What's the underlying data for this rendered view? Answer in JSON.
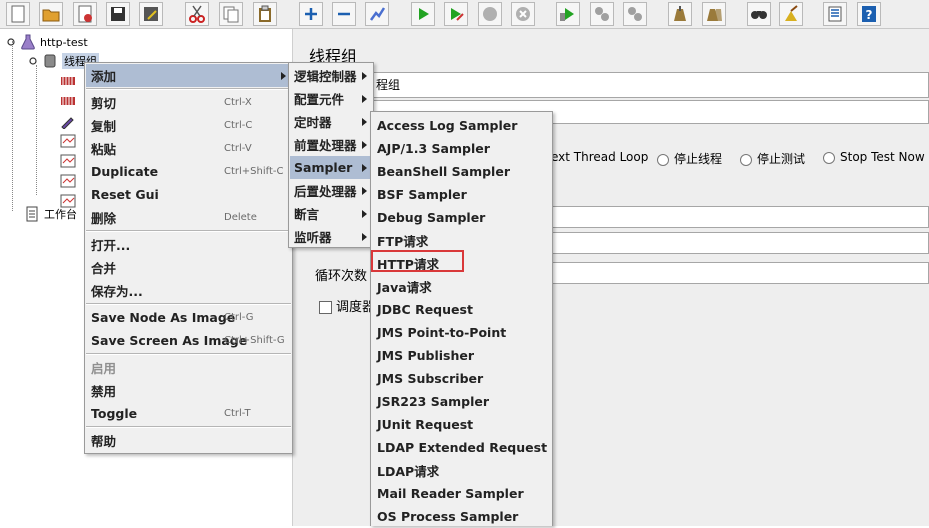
{
  "toolbar": {
    "buttons": [
      {
        "name": "new-icon",
        "color": "#ffffff"
      },
      {
        "name": "open-icon",
        "color": "#e0a030"
      },
      {
        "name": "templates-icon",
        "color": "#cc3333"
      },
      {
        "name": "save-icon",
        "color": "#333333"
      },
      {
        "name": "save-as-icon",
        "color": "#555555"
      },
      {
        "name": "cut-icon",
        "color": "#cc2222"
      },
      {
        "name": "copy-icon",
        "color": "#777777"
      },
      {
        "name": "paste-icon",
        "color": "#8a6a2a"
      },
      {
        "name": "expand-icon",
        "color": "#1b5fb0"
      },
      {
        "name": "collapse-icon",
        "color": "#1b5fb0"
      },
      {
        "name": "toggle-icon",
        "color": "#4a6fd0"
      },
      {
        "name": "start-icon",
        "color": "#22a322"
      },
      {
        "name": "start-no-pause-icon",
        "color": "#22a322"
      },
      {
        "name": "stop-icon",
        "color": "#b0b0b0"
      },
      {
        "name": "shutdown-icon",
        "color": "#b0b0b0"
      },
      {
        "name": "remote-start-icon",
        "color": "#22a322"
      },
      {
        "name": "remote-stop-icon",
        "color": "#a0a0a0"
      },
      {
        "name": "remote-shutdown-icon",
        "color": "#a0a0a0"
      },
      {
        "name": "clear-icon",
        "color": "#9a7a3a"
      },
      {
        "name": "clear-all-icon",
        "color": "#9a7a3a"
      },
      {
        "name": "search-icon",
        "color": "#333333"
      },
      {
        "name": "reset-search-icon",
        "color": "#d8b020"
      },
      {
        "name": "function-helper-icon",
        "color": "#1b5fb0"
      },
      {
        "name": "help-icon",
        "color": "#1b5fb0"
      }
    ]
  },
  "tree": {
    "root": "http-test",
    "thread_group": "线程组",
    "workbench": "工作台"
  },
  "right_panel": {
    "title": "线程组",
    "name_suffix": "程组",
    "next_thread_loop": "ext Thread Loop",
    "stop_thread": "停止线程",
    "stop_test": "停止测试",
    "stop_test_now": "Stop Test Now",
    "loop_count": "循环次数",
    "scheduler": "调度器"
  },
  "context_menu": {
    "items": [
      {
        "label": "添加",
        "shortcut": "",
        "submenu": true,
        "highlighted": true
      },
      {
        "label": "剪切",
        "shortcut": "Ctrl-X"
      },
      {
        "label": "复制",
        "shortcut": "Ctrl-C"
      },
      {
        "label": "粘贴",
        "shortcut": "Ctrl-V"
      },
      {
        "label": "Duplicate",
        "shortcut": "Ctrl+Shift-C"
      },
      {
        "label": "Reset Gui",
        "shortcut": ""
      },
      {
        "label": "删除",
        "shortcut": "Delete"
      },
      {
        "label": "打开...",
        "shortcut": ""
      },
      {
        "label": "合并",
        "shortcut": ""
      },
      {
        "label": "保存为...",
        "shortcut": ""
      },
      {
        "label": "Save Node As Image",
        "shortcut": "Ctrl-G"
      },
      {
        "label": "Save Screen As Image",
        "shortcut": "Ctrl+Shift-G"
      },
      {
        "label": "启用",
        "shortcut": "",
        "disabled": true
      },
      {
        "label": "禁用",
        "shortcut": ""
      },
      {
        "label": "Toggle",
        "shortcut": "Ctrl-T"
      },
      {
        "label": "帮助",
        "shortcut": ""
      }
    ]
  },
  "add_submenu": {
    "items": [
      {
        "label": "逻辑控制器"
      },
      {
        "label": "配置元件"
      },
      {
        "label": "定时器"
      },
      {
        "label": "前置处理器"
      },
      {
        "label": "Sampler",
        "highlighted": true
      },
      {
        "label": "后置处理器"
      },
      {
        "label": "断言"
      },
      {
        "label": "监听器"
      }
    ]
  },
  "sampler_submenu": {
    "items": [
      "Access Log Sampler",
      "AJP/1.3 Sampler",
      "BeanShell Sampler",
      "BSF Sampler",
      "Debug Sampler",
      "FTP请求",
      "HTTP请求",
      "Java请求",
      "JDBC Request",
      "JMS Point-to-Point",
      "JMS Publisher",
      "JMS Subscriber",
      "JSR223 Sampler",
      "JUnit Request",
      "LDAP Extended Request",
      "LDAP请求",
      "Mail Reader Sampler",
      "OS Process Sampler"
    ],
    "highlight_color": "#d9383a"
  }
}
